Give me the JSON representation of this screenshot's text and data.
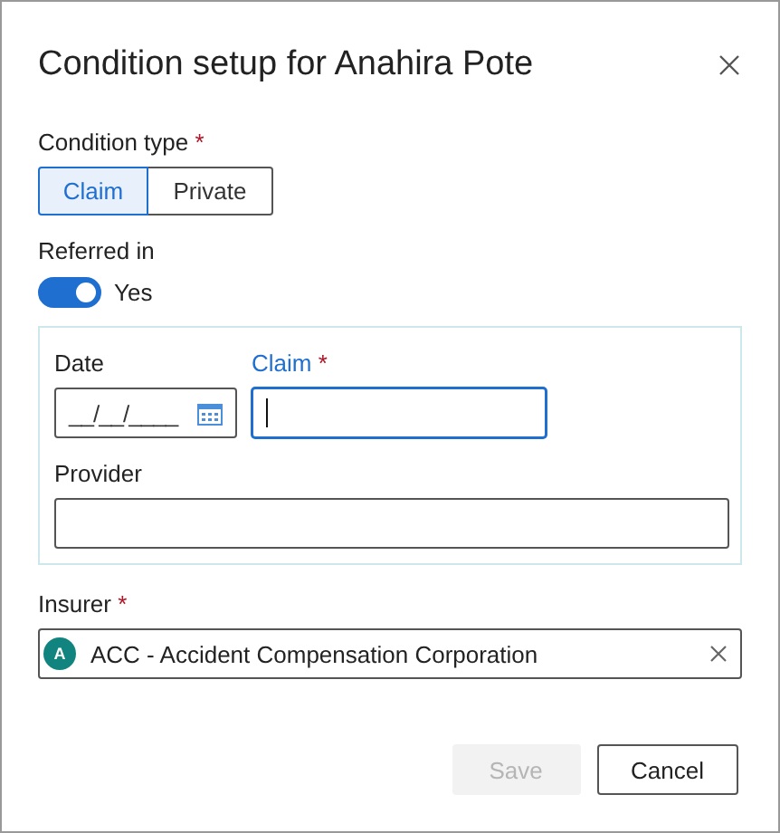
{
  "dialog": {
    "title": "Condition setup for Anahira Pote"
  },
  "condition_type": {
    "label": "Condition type",
    "required_mark": "*",
    "options": [
      {
        "label": "Claim",
        "selected": true
      },
      {
        "label": "Private",
        "selected": false
      }
    ]
  },
  "referred_in": {
    "label": "Referred in",
    "on": true,
    "state_label": "Yes"
  },
  "date": {
    "label": "Date",
    "placeholder": "__/__/____"
  },
  "claim": {
    "label": "Claim",
    "required_mark": "*",
    "focused": true
  },
  "provider": {
    "label": "Provider"
  },
  "insurer": {
    "label": "Insurer",
    "required_mark": "*",
    "avatar": "A",
    "value": "ACC - Accident Compensation Corporation"
  },
  "buttons": [
    {
      "label": "Save",
      "disabled": true
    },
    {
      "label": "Cancel",
      "disabled": false
    }
  ]
}
